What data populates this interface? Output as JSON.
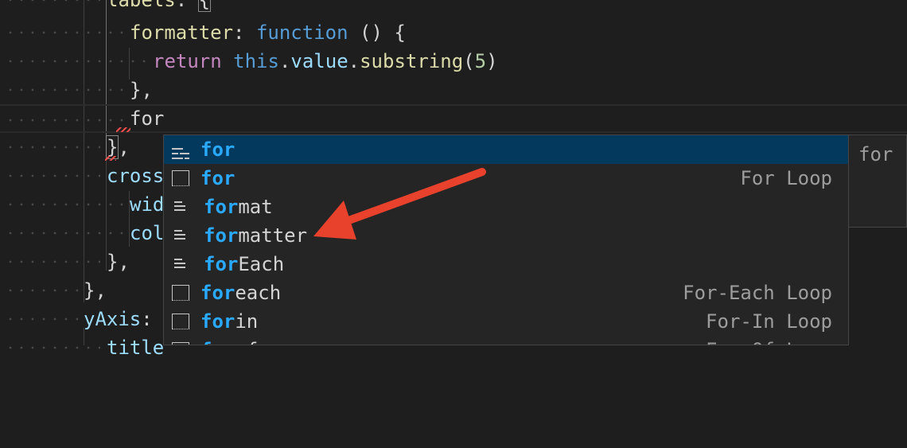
{
  "code_lines": {
    "l0": {
      "prop": "labels",
      "colon": ":",
      "brace": "{"
    },
    "l1": {
      "prop": "formatter",
      "colon": ":",
      "kw": "function",
      "rest": " () {"
    },
    "l2": {
      "ctrl": "return",
      "kw": "this",
      "dot1": ".",
      "prop": "value",
      "dot2": ".",
      "fn": "substring",
      "open": "(",
      "num": "5",
      "close": ")"
    },
    "l3": {
      "text": "},"
    },
    "l4": {
      "text": "for"
    },
    "l5": {
      "brace": "}",
      "comma": ","
    },
    "l6": {
      "prop": "cross"
    },
    "l7": {
      "prop": "wid"
    },
    "l8": {
      "prop": "col"
    },
    "l9": {
      "text": "},"
    },
    "l10": {
      "text": "},"
    },
    "l11": {
      "prop": "yAxis",
      "colon": ":"
    },
    "l12": {
      "prop": "title"
    }
  },
  "suggest": {
    "items": [
      {
        "match": "for",
        "rest": "",
        "detail": "",
        "icon": "keyword-icon",
        "selected": true
      },
      {
        "match": "for",
        "rest": "",
        "detail": "For Loop",
        "icon": "snippet-icon"
      },
      {
        "match": "for",
        "rest": "mat",
        "detail": "",
        "icon": "text-icon"
      },
      {
        "match": "for",
        "rest": "matter",
        "detail": "",
        "icon": "text-icon"
      },
      {
        "match": "for",
        "rest": "Each",
        "detail": "",
        "icon": "text-icon"
      },
      {
        "match": "for",
        "rest": "each",
        "detail": "For-Each Loop",
        "icon": "snippet-icon"
      },
      {
        "match": "for",
        "rest": "in",
        "detail": "For-In Loop",
        "icon": "snippet-icon"
      },
      {
        "match": "for",
        "rest": "of",
        "detail": "For-Of Loop",
        "icon": "snippet-icon"
      }
    ],
    "details_text": "for"
  },
  "annotation": {
    "arrow_color": "#e8412c"
  }
}
